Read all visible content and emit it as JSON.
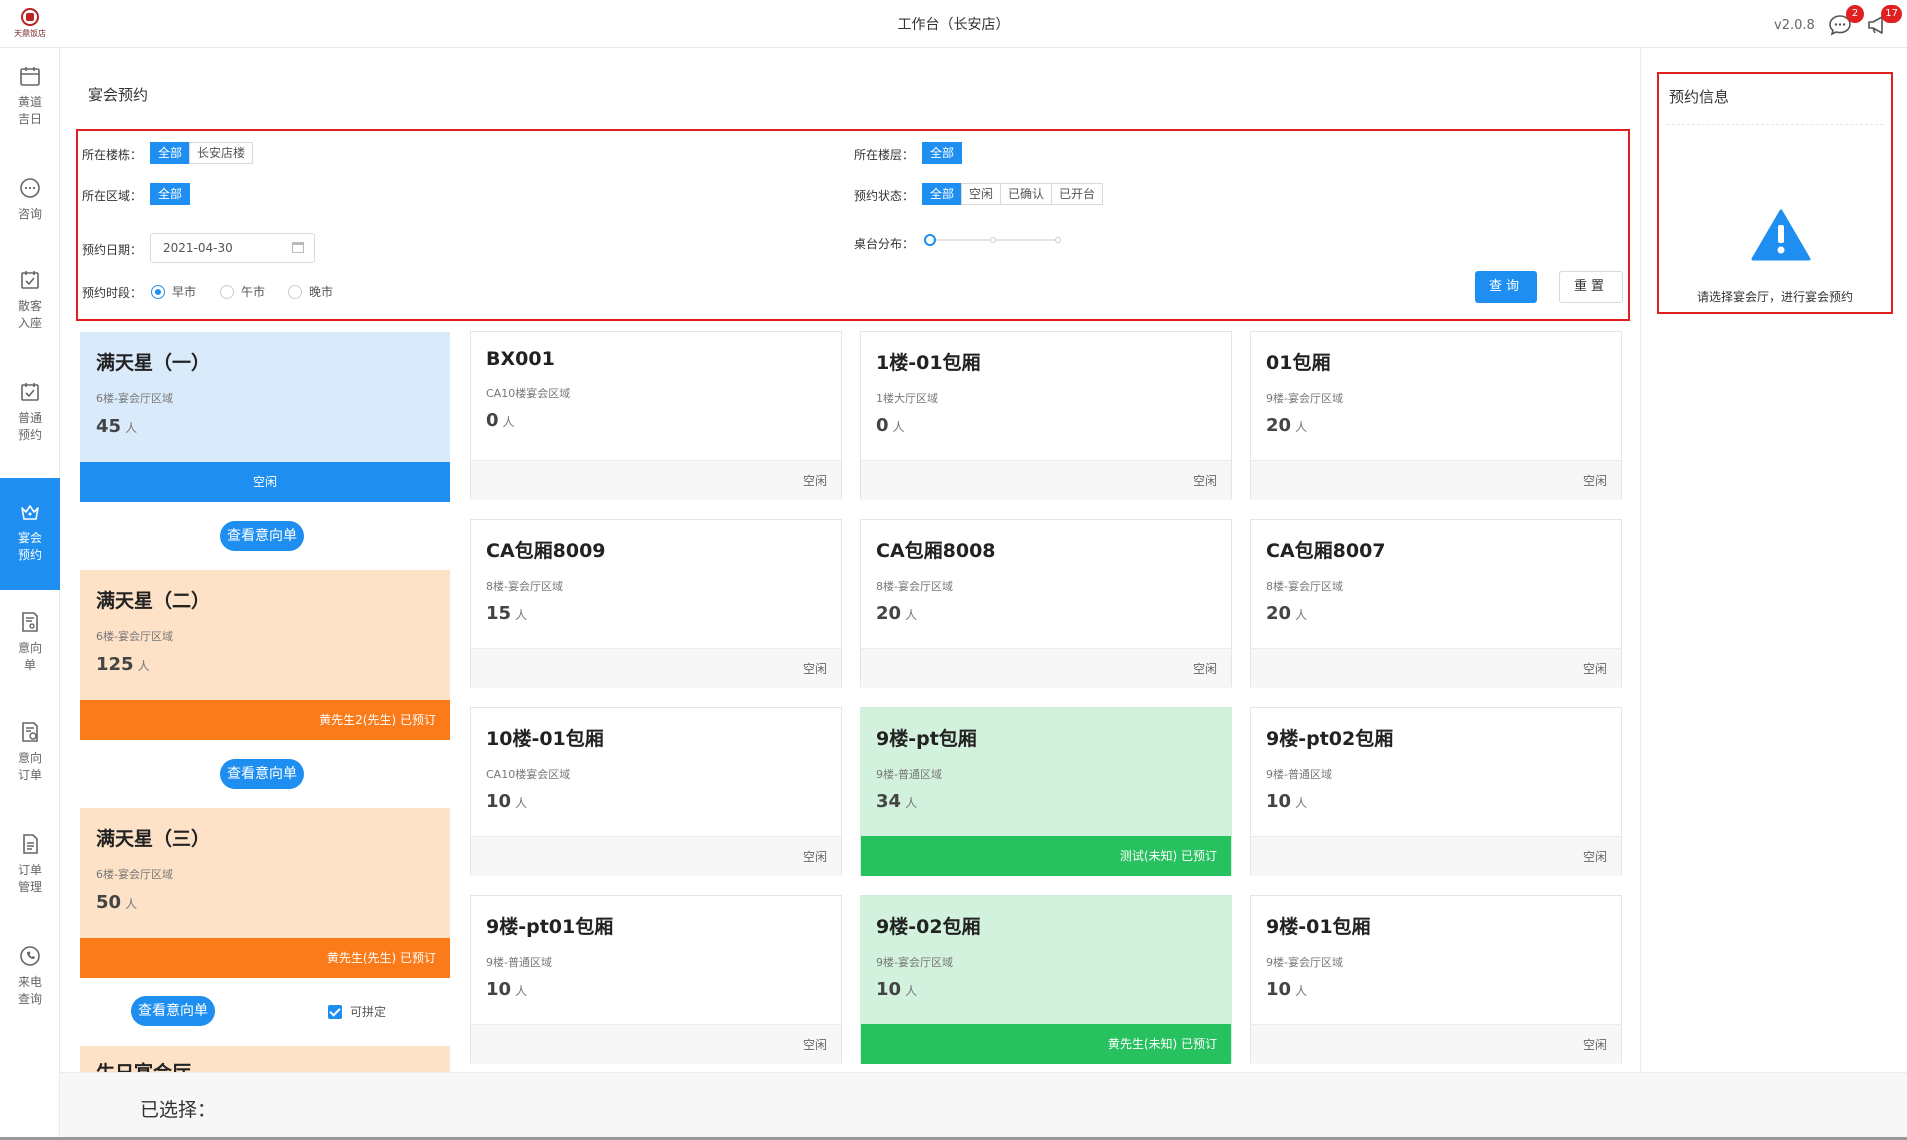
{
  "app": {
    "logo_text": "天鼎饭店",
    "title": "工作台（长安店）",
    "version": "v2.0.8",
    "messages_badge": "2",
    "notifications_badge": "17"
  },
  "sidebar": {
    "items": [
      {
        "label": "黄道吉日",
        "icon": "calendar-icon"
      },
      {
        "label": "咨询",
        "icon": "chat-icon"
      },
      {
        "label": "散客入座",
        "icon": "checkin-icon"
      },
      {
        "label": "普通预约",
        "icon": "checklist-icon"
      },
      {
        "label": "宴会预约",
        "icon": "crown-icon",
        "active": true
      },
      {
        "label": "意向单",
        "icon": "user-doc-icon"
      },
      {
        "label": "意向订单",
        "icon": "doc-check-icon"
      },
      {
        "label": "订单管理",
        "icon": "doc-icon"
      },
      {
        "label": "来电查询",
        "icon": "phone-icon"
      }
    ]
  },
  "main": {
    "section_title": "宴会预约",
    "filters": {
      "building": {
        "label": "所在楼栋：",
        "options": [
          "全部",
          "长安店楼"
        ],
        "selected": "全部"
      },
      "floor": {
        "label": "所在楼层：",
        "options": [
          "全部"
        ],
        "selected": "全部"
      },
      "zone": {
        "label": "所在区域：",
        "options": [
          "全部"
        ],
        "selected": "全部"
      },
      "status": {
        "label": "预约状态：",
        "options": [
          "全部",
          "空闲",
          "已确认",
          "已开台"
        ],
        "selected": "全部"
      },
      "date": {
        "label": "预约日期：",
        "value": "2021-04-30"
      },
      "tables": {
        "label": "桌台分布："
      },
      "period": {
        "label": "预约时段：",
        "options": [
          "早市",
          "午市",
          "晚市"
        ],
        "selected": "早市"
      },
      "query_label": "查询",
      "reset_label": "重置"
    },
    "halls": [
      {
        "name": "满天星（一）",
        "area": "6楼-宴会厅区域",
        "capacity": "45",
        "unit": "人",
        "status": "空闲",
        "color": "blue"
      },
      {
        "name": "满天星（二）",
        "area": "6楼-宴会厅区域",
        "capacity": "125",
        "unit": "人",
        "status": "黄先生2(先生) 已预订",
        "color": "orange"
      },
      {
        "name": "满天星（三）",
        "area": "6楼-宴会厅区域",
        "capacity": "50",
        "unit": "人",
        "status": "黄先生(先生) 已预订",
        "color": "orange"
      },
      {
        "name": "生日宴会厅"
      }
    ],
    "view_intent_label": "查看意向单",
    "combinable_label": "可拼定",
    "rooms": [
      {
        "name": "BX001",
        "area": "CA10楼宴会区域",
        "capacity": "0",
        "unit": "人",
        "status": "空闲"
      },
      {
        "name": "1楼-01包厢",
        "area": "1楼大厅区域",
        "capacity": "0",
        "unit": "人",
        "status": "空闲"
      },
      {
        "name": "01包厢",
        "area": "9楼-宴会厅区域",
        "capacity": "20",
        "unit": "人",
        "status": "空闲"
      },
      {
        "name": "CA包厢8009",
        "area": "8楼-宴会厅区域",
        "capacity": "15",
        "unit": "人",
        "status": "空闲"
      },
      {
        "name": "CA包厢8008",
        "area": "8楼-宴会厅区域",
        "capacity": "20",
        "unit": "人",
        "status": "空闲"
      },
      {
        "name": "CA包厢8007",
        "area": "8楼-宴会厅区域",
        "capacity": "20",
        "unit": "人",
        "status": "空闲"
      },
      {
        "name": "10楼-01包厢",
        "area": "CA10楼宴会区域",
        "capacity": "10",
        "unit": "人",
        "status": "空闲"
      },
      {
        "name": "9楼-pt包厢",
        "area": "9楼-普通区域",
        "capacity": "34",
        "unit": "人",
        "status": "测试(未知) 已预订",
        "booked": true
      },
      {
        "name": "9楼-pt02包厢",
        "area": "9楼-普通区域",
        "capacity": "10",
        "unit": "人",
        "status": "空闲"
      },
      {
        "name": "9楼-pt01包厢",
        "area": "9楼-普通区域",
        "capacity": "10",
        "unit": "人",
        "status": "空闲"
      },
      {
        "name": "9楼-02包厢",
        "area": "9楼-宴会厅区域",
        "capacity": "10",
        "unit": "人",
        "status": "黄先生(未知) 已预订",
        "booked": true
      },
      {
        "name": "9楼-01包厢",
        "area": "9楼-宴会厅区域",
        "capacity": "10",
        "unit": "人",
        "status": "空闲"
      }
    ]
  },
  "info_panel": {
    "title": "预约信息",
    "message": "请选择宴会厅，进行宴会预约"
  },
  "footer": {
    "selected_label": "已选择："
  },
  "colors": {
    "primary": "#1e8ff0",
    "booked_orange": "#fb7a1a",
    "booked_green": "#28c160",
    "highlight_red": "#e02020"
  }
}
